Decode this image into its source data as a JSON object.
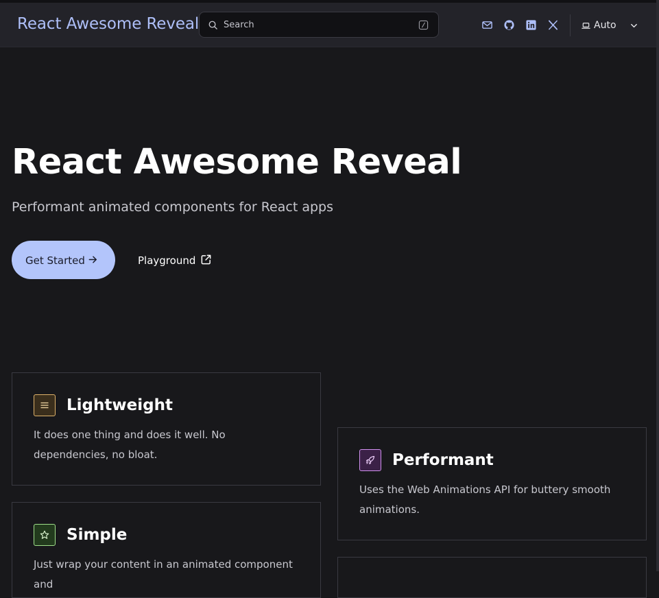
{
  "navbar": {
    "brand": "React Awesome Reveal",
    "search": {
      "placeholder": "Search"
    },
    "icons": [
      "mail-icon",
      "github-icon",
      "linkedin-icon",
      "x-twitter-icon"
    ],
    "theme": {
      "label": "Auto"
    }
  },
  "hero": {
    "title": "React Awesome Reveal",
    "subtitle": "Performant animated components for React apps",
    "primary_button": "Get Started",
    "secondary_button": "Playground"
  },
  "features": [
    {
      "title": "Lightweight",
      "description": "It does one thing and does it well. No dependencies, no bloat.",
      "icon": "menu-lines-icon",
      "accent": "#e0b36b"
    },
    {
      "title": "Performant",
      "description": "Uses the Web Animations API for buttery smooth animations.",
      "icon": "rocket-icon",
      "accent": "#d291f0"
    },
    {
      "title": "Simple",
      "description": "Just wrap your content in an animated component and",
      "icon": "star-icon",
      "accent": "#9fe08a"
    }
  ],
  "colors": {
    "background": "#18181b",
    "navbar": "#232329",
    "brand": "#aebff8",
    "primary_button": "#b3c5fb"
  }
}
